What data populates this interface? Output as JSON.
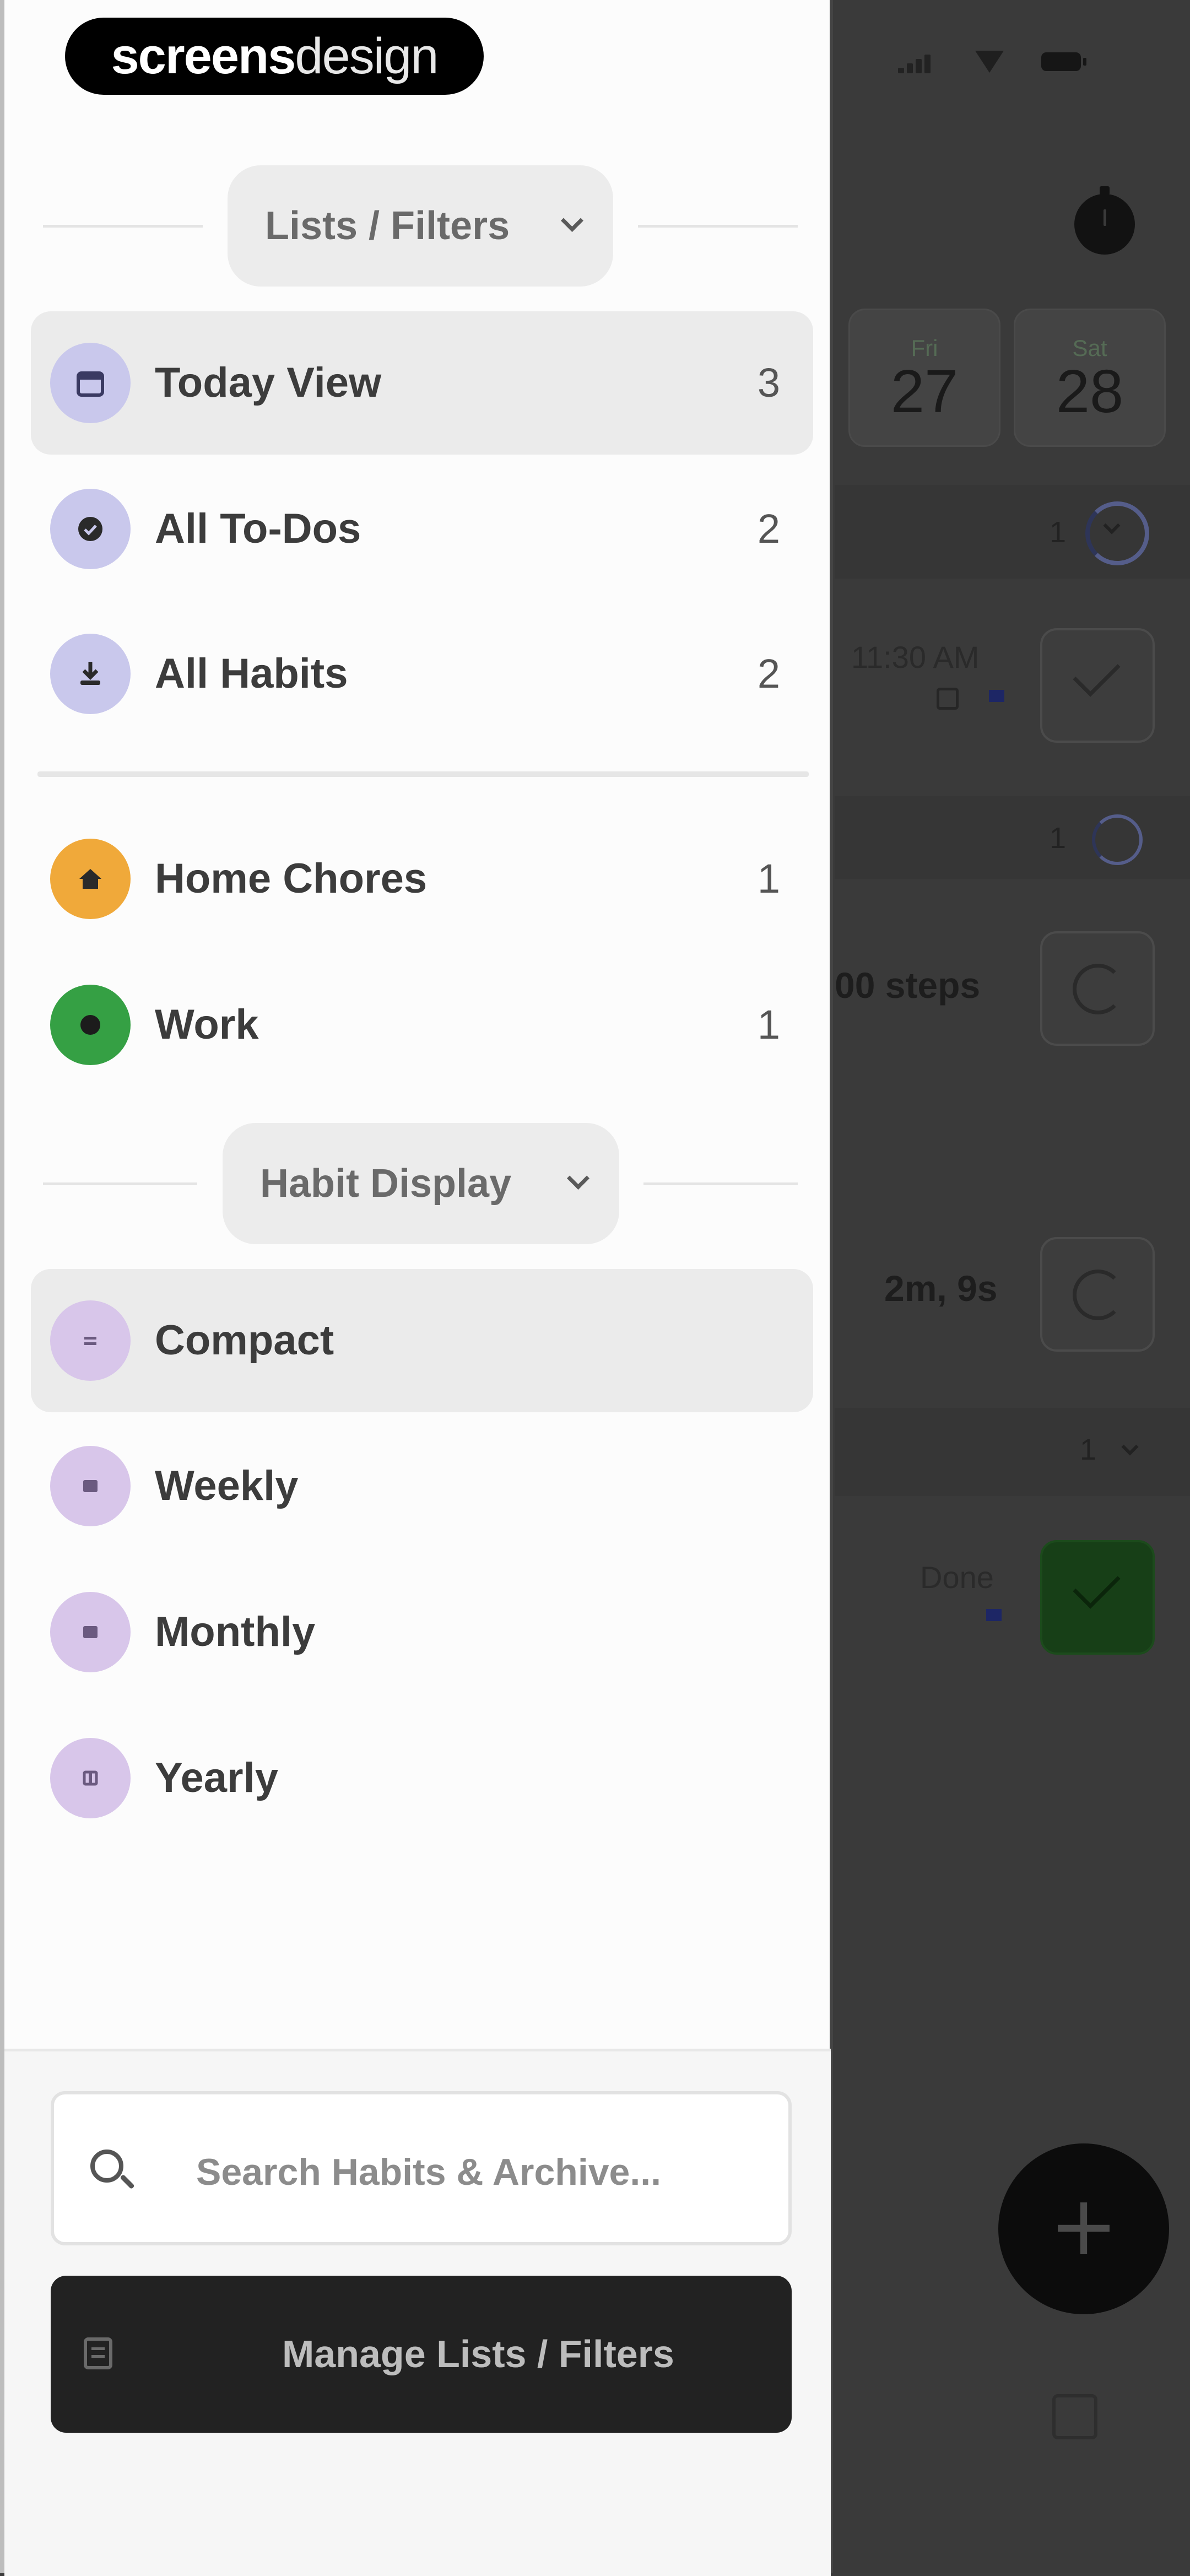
{
  "logo": {
    "bold": "screens",
    "light": "design"
  },
  "lists_header": {
    "label": "Lists / Filters"
  },
  "lists": [
    {
      "label": "Today View",
      "count": "3",
      "icon": "calendar-icon",
      "color": "#c9c8ec"
    },
    {
      "label": "All To-Dos",
      "count": "2",
      "icon": "check-circle-icon",
      "color": "#c9c8ec"
    },
    {
      "label": "All Habits",
      "count": "2",
      "icon": "habit-icon",
      "color": "#c9c8ec"
    }
  ],
  "custom_lists": [
    {
      "label": "Home Chores",
      "count": "1",
      "icon": "house-icon",
      "color": "#f0a93a"
    },
    {
      "label": "Work",
      "count": "1",
      "icon": "briefcase-icon",
      "color": "#35a044"
    }
  ],
  "habit_display_header": {
    "label": "Habit Display"
  },
  "habit_display": [
    {
      "label": "Compact",
      "icon": "compact-view-icon",
      "color": "#d8c6ea"
    },
    {
      "label": "Weekly",
      "icon": "weekly-view-icon",
      "color": "#d8c6ea"
    },
    {
      "label": "Monthly",
      "icon": "monthly-view-icon",
      "color": "#d8c6ea"
    },
    {
      "label": "Yearly",
      "icon": "yearly-view-icon",
      "color": "#d8c6ea"
    }
  ],
  "search": {
    "placeholder": "Search Habits & Archive..."
  },
  "manage_button": {
    "label": "Manage Lists / Filters"
  },
  "background": {
    "days": [
      {
        "dow": "Fri",
        "num": "27"
      },
      {
        "dow": "Sat",
        "num": "28"
      }
    ],
    "rows": [
      {
        "count": "1"
      },
      {
        "time": "11:30 AM"
      },
      {
        "count": "1"
      },
      {
        "text": "00 steps"
      },
      {
        "count": "1"
      },
      {
        "text": "2m, 9s"
      },
      {
        "count": "1"
      },
      {
        "status": "Done"
      }
    ]
  },
  "colors": {
    "accent_dark": "#222222",
    "habit_green": "#35a044",
    "chores_orange": "#f0a93a"
  }
}
